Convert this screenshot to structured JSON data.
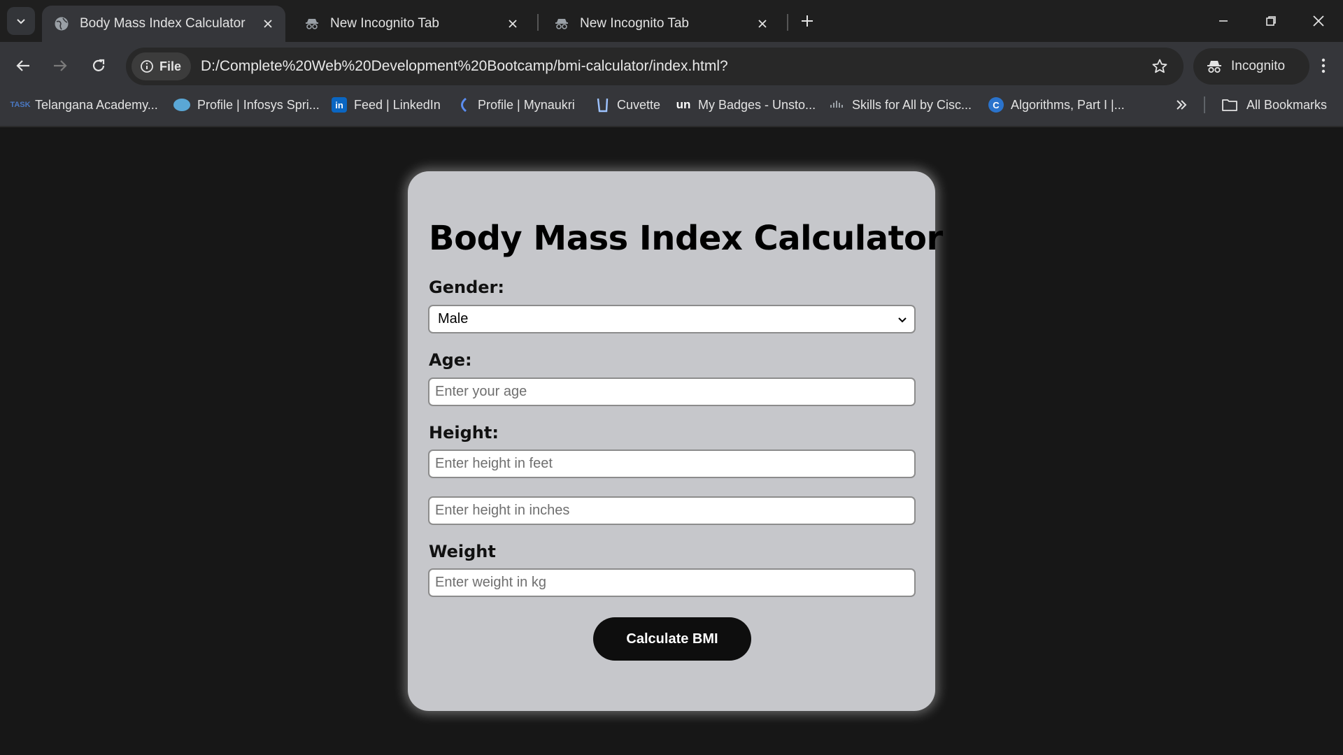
{
  "browser": {
    "tabs": [
      {
        "title": "Body Mass Index Calculator",
        "active": true
      },
      {
        "title": "New Incognito Tab",
        "active": false
      },
      {
        "title": "New Incognito Tab",
        "active": false
      }
    ],
    "address_chip": "File",
    "url": "D:/Complete%20Web%20Development%20Bootcamp/bmi-calculator/index.html?",
    "incognito_label": "Incognito",
    "bookmarks": [
      {
        "label": "Telangana Academy...",
        "icon": "telangana-icon"
      },
      {
        "label": "Profile | Infosys Spri...",
        "icon": "infosys-icon"
      },
      {
        "label": "Feed | LinkedIn",
        "icon": "linkedin-icon"
      },
      {
        "label": "Profile | Mynaukri",
        "icon": "mynaukri-icon"
      },
      {
        "label": "Cuvette",
        "icon": "cuvette-icon"
      },
      {
        "label": "My Badges - Unsto...",
        "icon": "unstop-icon"
      },
      {
        "label": "Skills for All by Cisc...",
        "icon": "cisco-icon"
      },
      {
        "label": "Algorithms, Part I |...",
        "icon": "coursera-icon"
      }
    ],
    "all_bookmarks_label": "All Bookmarks"
  },
  "form": {
    "title": "Body Mass Index Calculator",
    "gender_label": "Gender:",
    "gender_value": "Male",
    "age_label": "Age:",
    "age_placeholder": "Enter your age",
    "height_label": "Height:",
    "height_feet_placeholder": "Enter height in feet",
    "height_inches_placeholder": "Enter height in inches",
    "weight_label": "Weight",
    "weight_placeholder": "Enter weight in kg",
    "submit_label": "Calculate BMI"
  },
  "colors": {
    "page_bg": "#171717",
    "card_bg": "#c6c7cb",
    "button_bg": "#0e0e0e",
    "chrome_bg": "#35363a"
  }
}
